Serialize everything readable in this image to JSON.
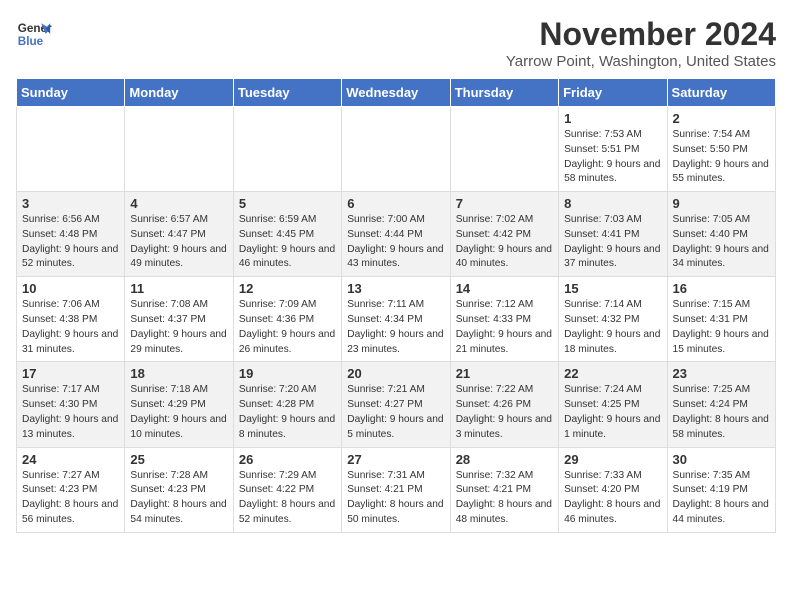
{
  "header": {
    "logo_line1": "General",
    "logo_line2": "Blue",
    "title": "November 2024",
    "subtitle": "Yarrow Point, Washington, United States"
  },
  "calendar": {
    "days_of_week": [
      "Sunday",
      "Monday",
      "Tuesday",
      "Wednesday",
      "Thursday",
      "Friday",
      "Saturday"
    ],
    "weeks": [
      [
        {
          "day": "",
          "info": ""
        },
        {
          "day": "",
          "info": ""
        },
        {
          "day": "",
          "info": ""
        },
        {
          "day": "",
          "info": ""
        },
        {
          "day": "",
          "info": ""
        },
        {
          "day": "1",
          "info": "Sunrise: 7:53 AM\nSunset: 5:51 PM\nDaylight: 9 hours and 58 minutes."
        },
        {
          "day": "2",
          "info": "Sunrise: 7:54 AM\nSunset: 5:50 PM\nDaylight: 9 hours and 55 minutes."
        }
      ],
      [
        {
          "day": "3",
          "info": "Sunrise: 6:56 AM\nSunset: 4:48 PM\nDaylight: 9 hours and 52 minutes."
        },
        {
          "day": "4",
          "info": "Sunrise: 6:57 AM\nSunset: 4:47 PM\nDaylight: 9 hours and 49 minutes."
        },
        {
          "day": "5",
          "info": "Sunrise: 6:59 AM\nSunset: 4:45 PM\nDaylight: 9 hours and 46 minutes."
        },
        {
          "day": "6",
          "info": "Sunrise: 7:00 AM\nSunset: 4:44 PM\nDaylight: 9 hours and 43 minutes."
        },
        {
          "day": "7",
          "info": "Sunrise: 7:02 AM\nSunset: 4:42 PM\nDaylight: 9 hours and 40 minutes."
        },
        {
          "day": "8",
          "info": "Sunrise: 7:03 AM\nSunset: 4:41 PM\nDaylight: 9 hours and 37 minutes."
        },
        {
          "day": "9",
          "info": "Sunrise: 7:05 AM\nSunset: 4:40 PM\nDaylight: 9 hours and 34 minutes."
        }
      ],
      [
        {
          "day": "10",
          "info": "Sunrise: 7:06 AM\nSunset: 4:38 PM\nDaylight: 9 hours and 31 minutes."
        },
        {
          "day": "11",
          "info": "Sunrise: 7:08 AM\nSunset: 4:37 PM\nDaylight: 9 hours and 29 minutes."
        },
        {
          "day": "12",
          "info": "Sunrise: 7:09 AM\nSunset: 4:36 PM\nDaylight: 9 hours and 26 minutes."
        },
        {
          "day": "13",
          "info": "Sunrise: 7:11 AM\nSunset: 4:34 PM\nDaylight: 9 hours and 23 minutes."
        },
        {
          "day": "14",
          "info": "Sunrise: 7:12 AM\nSunset: 4:33 PM\nDaylight: 9 hours and 21 minutes."
        },
        {
          "day": "15",
          "info": "Sunrise: 7:14 AM\nSunset: 4:32 PM\nDaylight: 9 hours and 18 minutes."
        },
        {
          "day": "16",
          "info": "Sunrise: 7:15 AM\nSunset: 4:31 PM\nDaylight: 9 hours and 15 minutes."
        }
      ],
      [
        {
          "day": "17",
          "info": "Sunrise: 7:17 AM\nSunset: 4:30 PM\nDaylight: 9 hours and 13 minutes."
        },
        {
          "day": "18",
          "info": "Sunrise: 7:18 AM\nSunset: 4:29 PM\nDaylight: 9 hours and 10 minutes."
        },
        {
          "day": "19",
          "info": "Sunrise: 7:20 AM\nSunset: 4:28 PM\nDaylight: 9 hours and 8 minutes."
        },
        {
          "day": "20",
          "info": "Sunrise: 7:21 AM\nSunset: 4:27 PM\nDaylight: 9 hours and 5 minutes."
        },
        {
          "day": "21",
          "info": "Sunrise: 7:22 AM\nSunset: 4:26 PM\nDaylight: 9 hours and 3 minutes."
        },
        {
          "day": "22",
          "info": "Sunrise: 7:24 AM\nSunset: 4:25 PM\nDaylight: 9 hours and 1 minute."
        },
        {
          "day": "23",
          "info": "Sunrise: 7:25 AM\nSunset: 4:24 PM\nDaylight: 8 hours and 58 minutes."
        }
      ],
      [
        {
          "day": "24",
          "info": "Sunrise: 7:27 AM\nSunset: 4:23 PM\nDaylight: 8 hours and 56 minutes."
        },
        {
          "day": "25",
          "info": "Sunrise: 7:28 AM\nSunset: 4:23 PM\nDaylight: 8 hours and 54 minutes."
        },
        {
          "day": "26",
          "info": "Sunrise: 7:29 AM\nSunset: 4:22 PM\nDaylight: 8 hours and 52 minutes."
        },
        {
          "day": "27",
          "info": "Sunrise: 7:31 AM\nSunset: 4:21 PM\nDaylight: 8 hours and 50 minutes."
        },
        {
          "day": "28",
          "info": "Sunrise: 7:32 AM\nSunset: 4:21 PM\nDaylight: 8 hours and 48 minutes."
        },
        {
          "day": "29",
          "info": "Sunrise: 7:33 AM\nSunset: 4:20 PM\nDaylight: 8 hours and 46 minutes."
        },
        {
          "day": "30",
          "info": "Sunrise: 7:35 AM\nSunset: 4:19 PM\nDaylight: 8 hours and 44 minutes."
        }
      ]
    ]
  }
}
